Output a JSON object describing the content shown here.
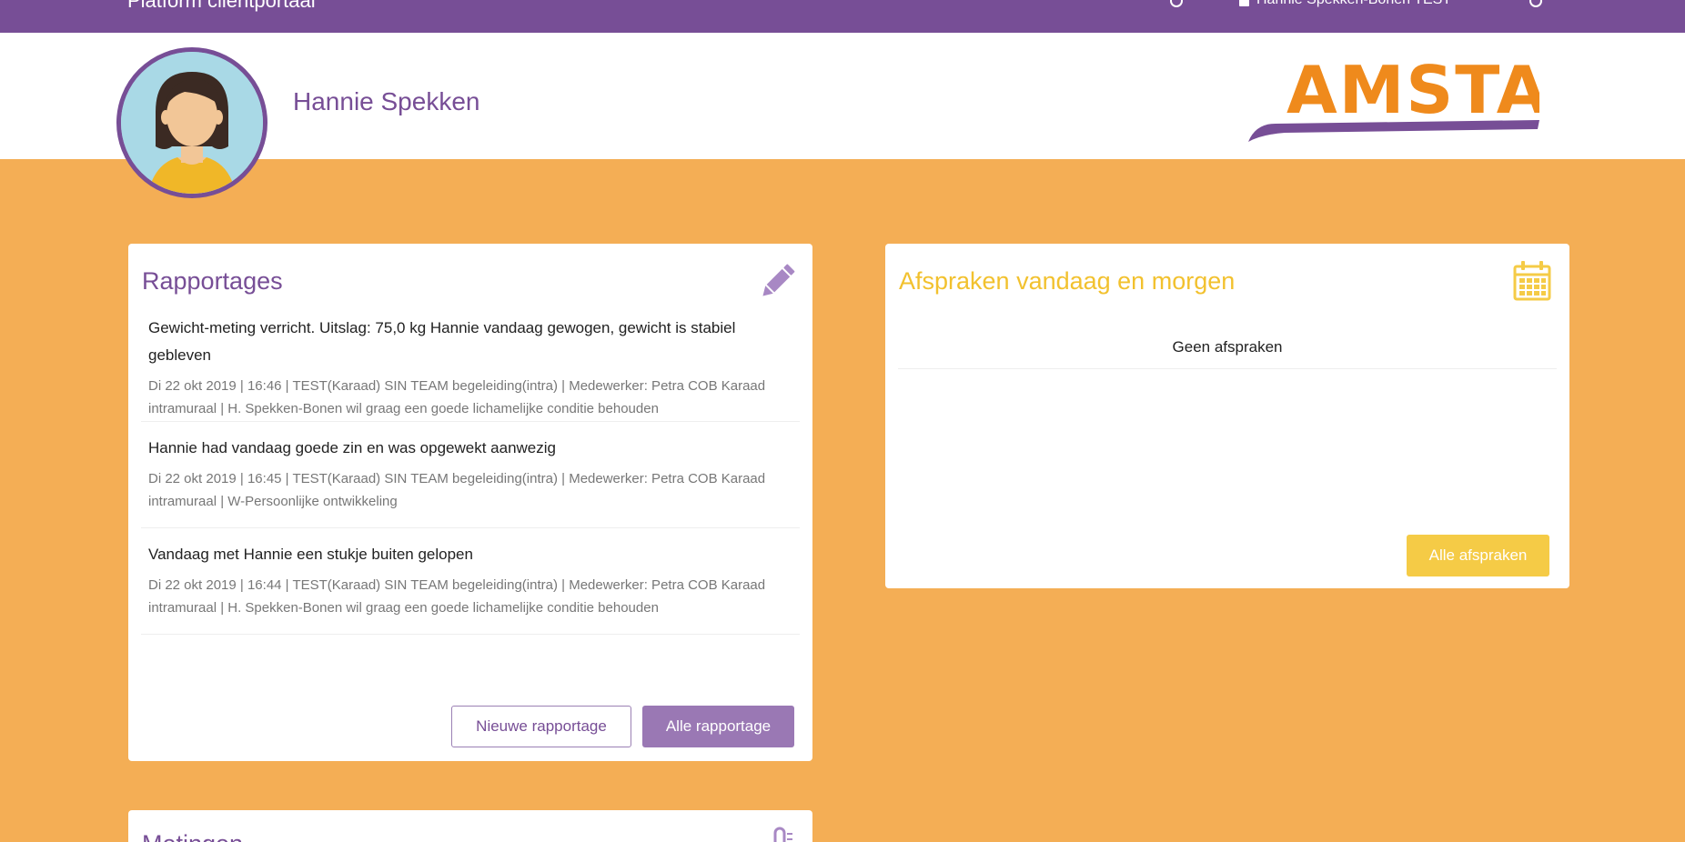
{
  "topbar": {
    "brand": "Platform cliëntportaal",
    "user_label": "Hannie Spekken-Bonen TEST"
  },
  "header": {
    "client_name": "Hannie Spekken",
    "logo_text": "AMSTA"
  },
  "rapportages": {
    "title": "Rapportages",
    "items": [
      {
        "text": "Gewicht-meting verricht. Uitslag: 75,0 kg Hannie vandaag gewogen, gewicht is stabiel gebleven",
        "meta": "Di 22 okt 2019 | 16:46 | TEST(Karaad) SIN TEAM begeleiding(intra) | Medewerker: Petra COB Karaad intramuraal | H. Spekken-Bonen wil graag een goede lichamelijke conditie behouden"
      },
      {
        "text": "Hannie had vandaag goede zin en was opgewekt aanwezig",
        "meta": "Di 22 okt 2019 | 16:45 | TEST(Karaad) SIN TEAM begeleiding(intra) | Medewerker: Petra COB Karaad intramuraal | W-Persoonlijke ontwikkeling"
      },
      {
        "text": "Vandaag met Hannie een stukje buiten gelopen",
        "meta": "Di 22 okt 2019 | 16:44 | TEST(Karaad) SIN TEAM begeleiding(intra) | Medewerker: Petra COB Karaad intramuraal | H. Spekken-Bonen wil graag een goede lichamelijke conditie behouden"
      }
    ],
    "new_button": "Nieuwe rapportage",
    "all_button": "Alle rapportage"
  },
  "afspraken": {
    "title": "Afspraken vandaag en morgen",
    "empty_text": "Geen afspraken",
    "all_button": "Alle afspraken"
  },
  "metingen": {
    "title": "Metingen"
  },
  "colors": {
    "purple": "#774e96",
    "orange_bg": "#f4ae55",
    "yellow": "#f5cb46"
  }
}
